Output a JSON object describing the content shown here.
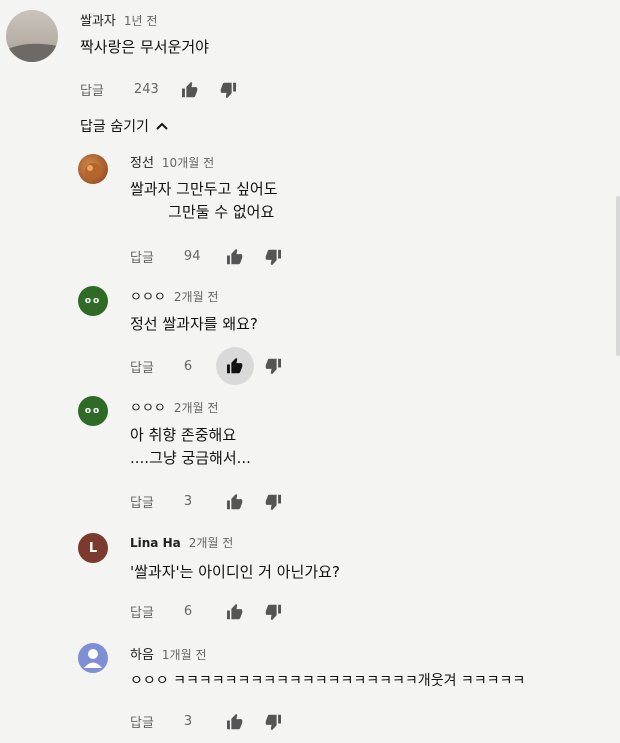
{
  "comments": [
    {
      "author": "쌀과자",
      "time": "1년 전",
      "lines": [
        "짝사랑은 무서운거야"
      ],
      "reply_label": "답글",
      "likes": "243",
      "liked": false,
      "avatar": {
        "icon": "profile-photo",
        "bg": "#bdb6ae",
        "letter": ""
      }
    },
    {
      "author": "정선",
      "time": "10개월 전",
      "lines": [
        "쌀과자 그만두고 싶어도",
        "        그만둘 수 없어요"
      ],
      "reply_label": "답글",
      "likes": "94",
      "liked": false,
      "avatar": {
        "icon": "food-photo",
        "bg": "#a0552a",
        "letter": ""
      }
    },
    {
      "author": "ㅇㅇㅇ",
      "time": "2개월 전",
      "lines": [
        "정선 쌀과자를 왜요?"
      ],
      "reply_label": "답글",
      "likes": "6",
      "liked": true,
      "avatar": {
        "icon": "eyes-avatar",
        "bg": "#2f6b27",
        "letter": "oo"
      }
    },
    {
      "author": "ㅇㅇㅇ",
      "time": "2개월 전",
      "lines": [
        "아 취향 존중해요",
        "....그냥 궁금해서..."
      ],
      "reply_label": "답글",
      "likes": "3",
      "liked": false,
      "avatar": {
        "icon": "eyes-avatar",
        "bg": "#2f6b27",
        "letter": "oo"
      }
    },
    {
      "author": "Lina Ha",
      "time": "2개월 전",
      "lines": [
        "'쌀과자'는 아이디인 거 아닌가요?"
      ],
      "reply_label": "답글",
      "likes": "6",
      "liked": false,
      "avatar": {
        "icon": "letter-avatar",
        "bg": "#7a3b2e",
        "letter": "L"
      }
    },
    {
      "author": "하음",
      "time": "1개월 전",
      "lines": [
        "ㅇㅇㅇ ㅋㅋㅋㅋㅋㅋㅋㅋㅋㅋㅋㅋㅋㅋㅋㅋㅋㅋㅋ개웃겨 ㅋㅋㅋㅋㅋ"
      ],
      "reply_label": "답글",
      "likes": "3",
      "liked": false,
      "avatar": {
        "icon": "default-user-icon",
        "bg": "#7f8fd6",
        "letter": ""
      }
    }
  ],
  "hide_replies_label": "답글 숨기기",
  "icons": {
    "like": "thumbs-up-icon",
    "dislike": "thumbs-down-icon",
    "collapse": "chevron-up-icon"
  }
}
